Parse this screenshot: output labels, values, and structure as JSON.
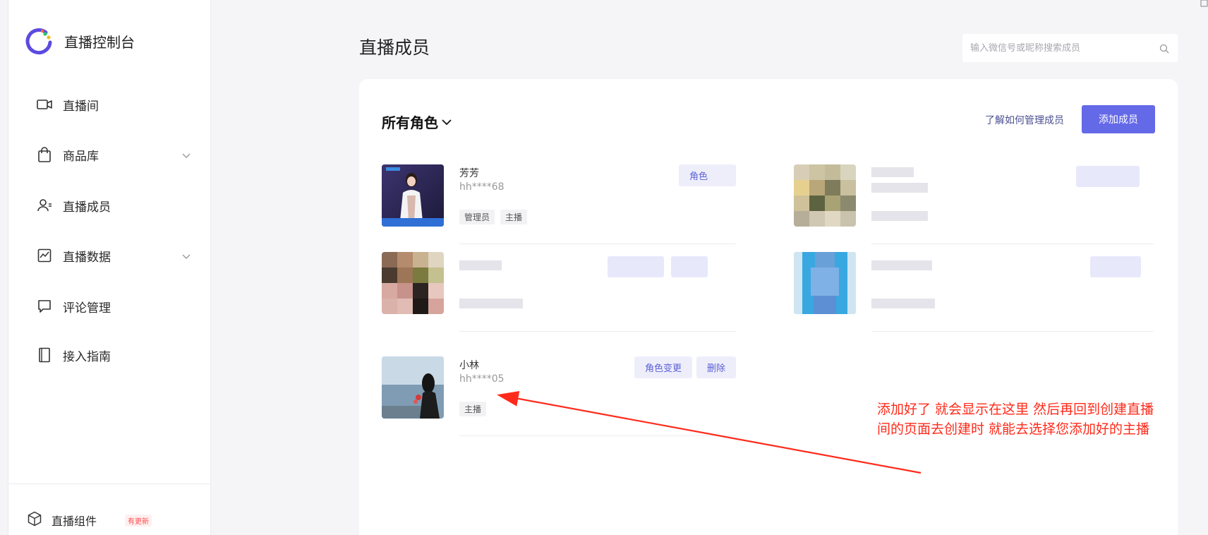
{
  "sidebar": {
    "brand_title": "直播控制台",
    "items": [
      {
        "label": "直播间",
        "icon": "video-camera-icon",
        "has_chevron": false
      },
      {
        "label": "商品库",
        "icon": "shopping-bag-icon",
        "has_chevron": true
      },
      {
        "label": "直播成员",
        "icon": "members-icon",
        "has_chevron": false
      },
      {
        "label": "直播数据",
        "icon": "chart-icon",
        "has_chevron": true
      },
      {
        "label": "评论管理",
        "icon": "comment-icon",
        "has_chevron": false
      },
      {
        "label": "接入指南",
        "icon": "book-icon",
        "has_chevron": false
      }
    ],
    "widget": {
      "label": "直播组件",
      "badge": "有更新",
      "icon": "cube-icon"
    }
  },
  "header": {
    "title": "直播成员",
    "search_placeholder": "输入微信号或昵称搜索成员"
  },
  "toolbar": {
    "role_filter": "所有角色",
    "learn_link": "了解如何管理成员",
    "add_button": "添加成员"
  },
  "members": [
    {
      "name": "芳芳",
      "account": "hh****68",
      "tags": [
        "管理员",
        "主播"
      ],
      "action_partial": "角色"
    },
    {
      "name": "小林",
      "account": "hh****05",
      "tags": [
        "主播"
      ],
      "actions": [
        "角色变更",
        "删除"
      ]
    }
  ],
  "annotation": {
    "line1": "添加好了  就会显示在这里  然后再回到创建直播",
    "line2": "间的页面去创建时 就能去选择您添加好的主播",
    "color": "#ff2a1a"
  },
  "colors": {
    "accent": "#6469e8",
    "link": "#4b4f8f"
  }
}
